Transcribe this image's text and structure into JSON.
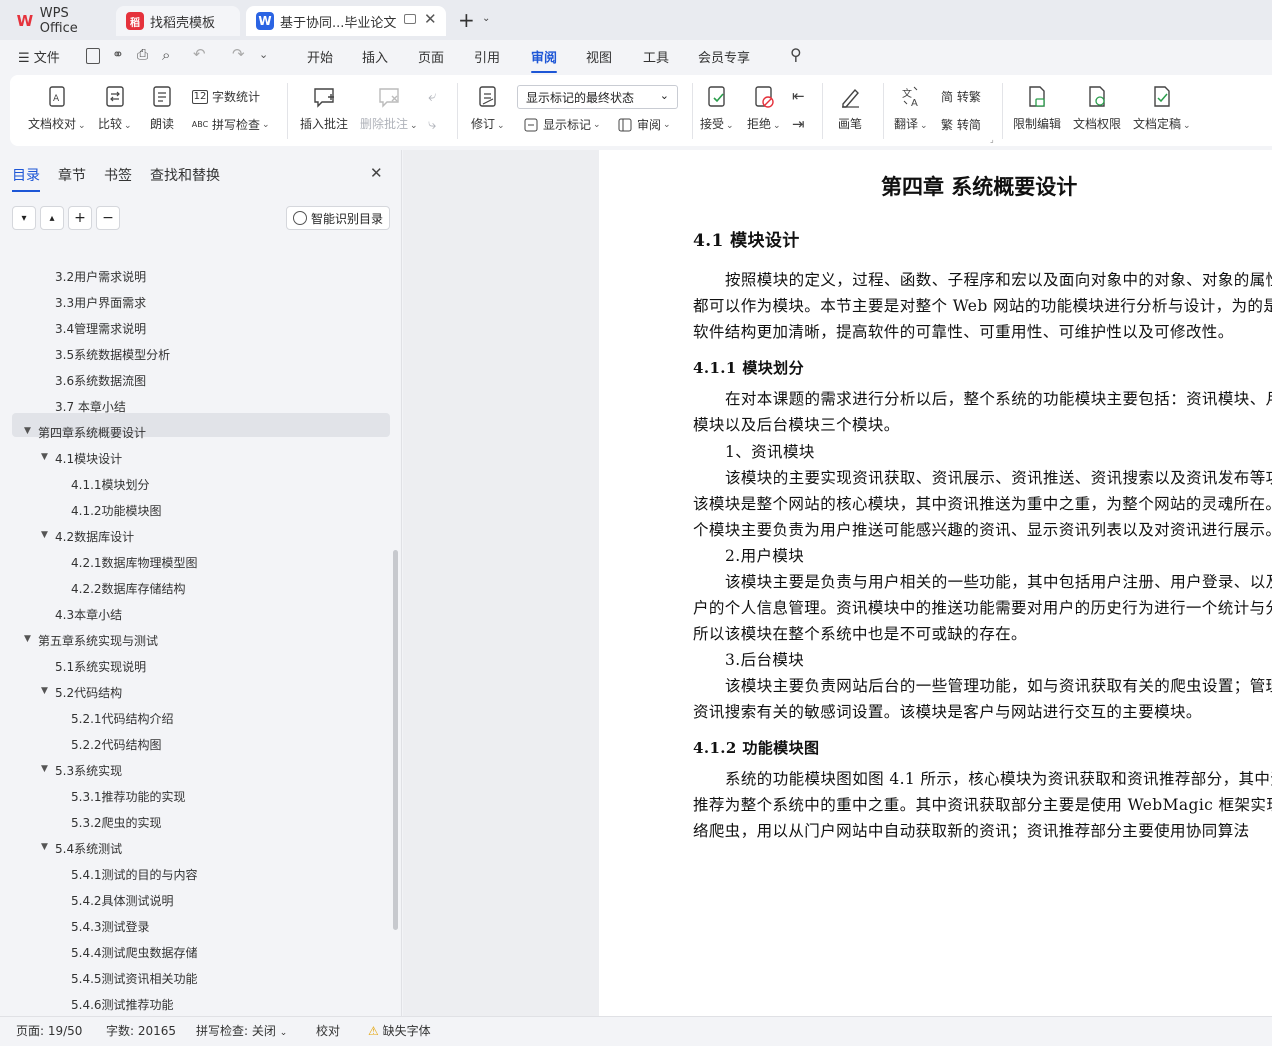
{
  "tabs": [
    {
      "label": "WPS Office",
      "icon": "wps-logo-icon"
    },
    {
      "label": "找稻壳模板",
      "icon": "docer-logo-icon"
    },
    {
      "label": "基于协同...毕业论文",
      "icon": "word-doc-icon"
    }
  ],
  "menu": {
    "file": "文件",
    "items": [
      "开始",
      "插入",
      "页面",
      "引用",
      "审阅",
      "视图",
      "工具",
      "会员专享"
    ],
    "active": "审阅"
  },
  "ribbon": {
    "doc_check": "文档校对",
    "compare": "比较",
    "read_aloud": "朗读",
    "word_count": "字数统计",
    "spell_check": "拼写检查",
    "insert_comment": "插入批注",
    "delete_comment": "删除批注",
    "revise": "修订",
    "markup_state": "显示标记的最终状态",
    "show_markup": "显示标记",
    "review_pane": "审阅",
    "accept": "接受",
    "reject": "拒绝",
    "pen": "画笔",
    "translate": "翻译",
    "to_traditional": "简 转繁",
    "to_simplified": "繁 转简",
    "restrict_edit": "限制编辑",
    "doc_permission": "文档权限",
    "doc_finalize": "文档定稿"
  },
  "nav": {
    "tabs": [
      "目录",
      "章节",
      "书签",
      "查找和替换"
    ],
    "smart_toc": "智能识别目录",
    "toc": [
      {
        "label": "3.2用户需求说明"
      },
      {
        "label": "3.3用户界面需求"
      },
      {
        "label": "3.4管理需求说明"
      },
      {
        "label": "3.5系统数据模型分析"
      },
      {
        "label": "3.6系统数据流图"
      },
      {
        "label": "3.7  本章小结"
      },
      {
        "label": "第四章系统概要设计"
      },
      {
        "label": "4.1模块设计"
      },
      {
        "label": "4.1.1模块划分"
      },
      {
        "label": "4.1.2功能模块图"
      },
      {
        "label": "4.2数据库设计"
      },
      {
        "label": "4.2.1数据库物理模型图"
      },
      {
        "label": "4.2.2数据库存储结构"
      },
      {
        "label": "4.3本章小结"
      },
      {
        "label": "第五章系统实现与测试"
      },
      {
        "label": "5.1系统实现说明"
      },
      {
        "label": "5.2代码结构"
      },
      {
        "label": "5.2.1代码结构介绍"
      },
      {
        "label": "5.2.2代码结构图"
      },
      {
        "label": "5.3系统实现"
      },
      {
        "label": "5.3.1推荐功能的实现"
      },
      {
        "label": "5.3.2爬虫的实现"
      },
      {
        "label": "5.4系统测试"
      },
      {
        "label": "5.4.1测试的目的与内容"
      },
      {
        "label": "5.4.2具体测试说明"
      },
      {
        "label": "5.4.3测试登录"
      },
      {
        "label": "5.4.4测试爬虫数据存储"
      },
      {
        "label": "5.4.5测试资讯相关功能"
      },
      {
        "label": "5.4.6测试推荐功能"
      }
    ]
  },
  "document": {
    "chapter_title": "第四章  系统概要设计",
    "lines": [
      "4.1  模块设计",
      "按照模块的定义，过程、函数、子程序和宏以及面向对象中的对象、对象的属性",
      "都可以作为模块。本节主要是对整个 Web 网站的功能模块进行分析与设计，为的是",
      "软件结构更加清晰，提高软件的可靠性、可重用性、可维护性以及可修改性。",
      "4.1.1  模块划分",
      "在对本课题的需求进行分析以后，整个系统的功能模块主要包括：资讯模块、月",
      "模块以及后台模块三个模块。",
      "1、资讯模块",
      "该模块的主要实现资讯获取、资讯展示、资讯推送、资讯搜索以及资讯发布等功",
      "该模块是整个网站的核心模块，其中资讯推送为重中之重，为整个网站的灵魂所在。",
      "个模块主要负责为用户推送可能感兴趣的资讯、显示资讯列表以及对资讯进行展示。",
      "2.用户模块",
      "该模块主要是负责与用户相关的一些功能，其中包括用户注册、用户登录、以及",
      "户的个人信息管理。资讯模块中的推送功能需要对用户的历史行为进行一个统计与分",
      "所以该模块在整个系统中也是不可或缺的存在。",
      "3.后台模块",
      "该模块主要负责网站后台的一些管理功能，如与资讯获取有关的爬虫设置；管理",
      "资讯搜索有关的敏感词设置。该模块是客户与网站进行交互的主要模块。",
      "4.1.2  功能模块图",
      "系统的功能模块图如图 4.1 所示，核心模块为资讯获取和资讯推荐部分，其中资",
      "推荐为整个系统中的重中之重。其中资讯获取部分主要是使用 WebMagic 框架实现的",
      "络爬虫，用以从门户网站中自动获取新的资讯；资讯推荐部分主要使用协同算法"
    ]
  },
  "status": {
    "page": "页面: 19/50",
    "words": "字数: 20165",
    "spell": "拼写检查: 关闭",
    "proof": "校对",
    "missing_font": "缺失字体"
  },
  "colors": {
    "accent": "#1d56d6",
    "wps_red": "#e5323c"
  }
}
